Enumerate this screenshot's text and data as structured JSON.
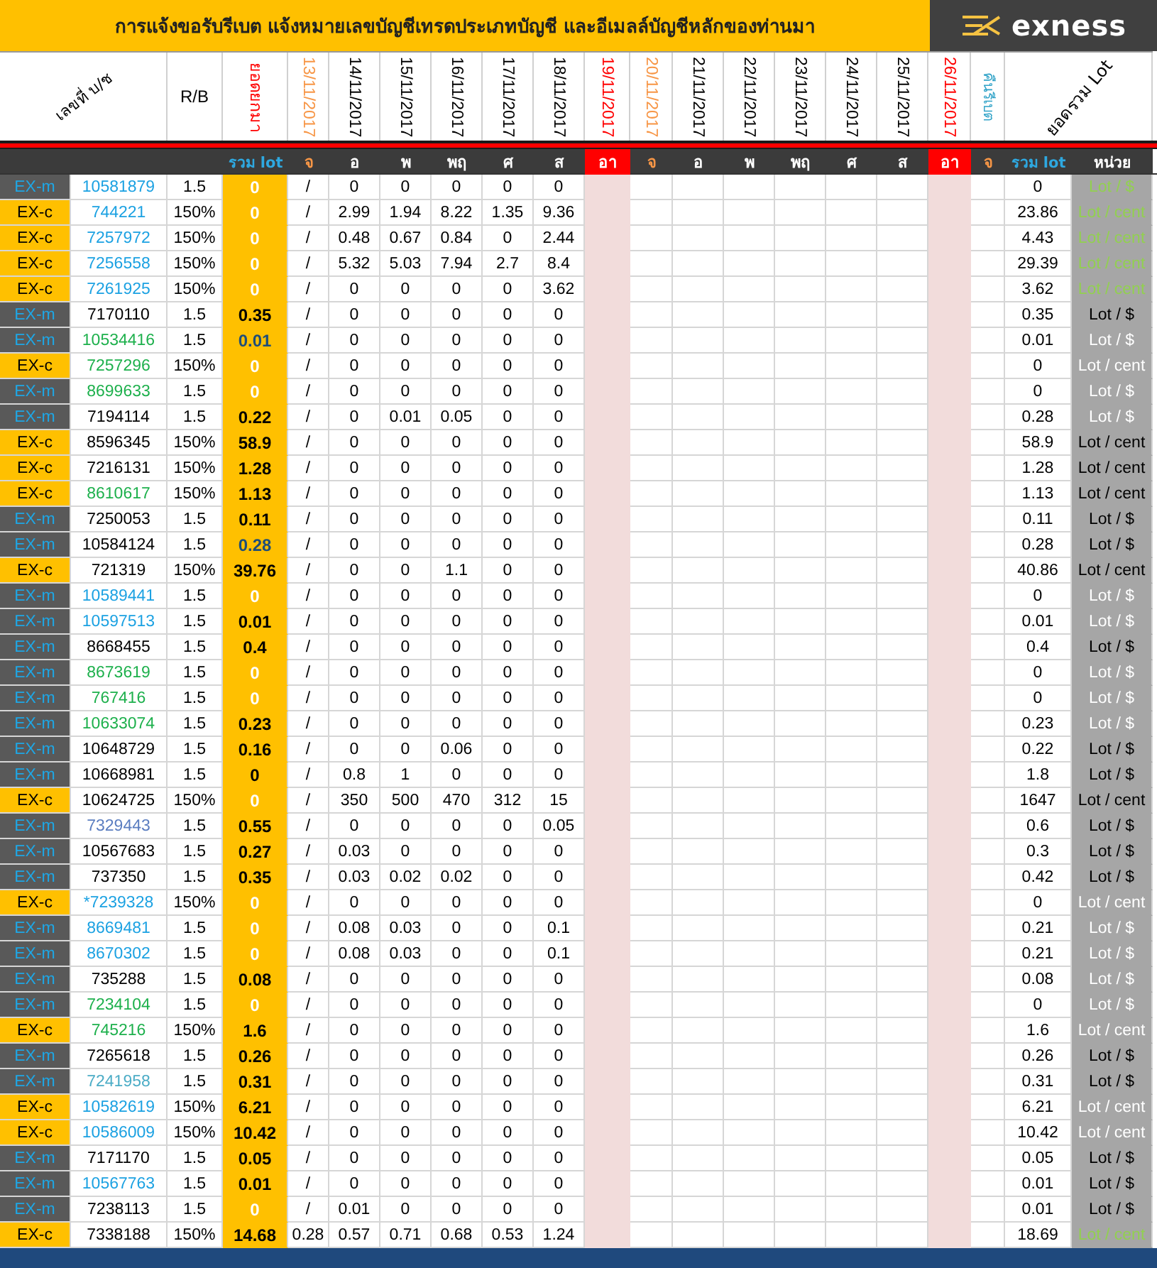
{
  "title": "การแจ้งขอรับรีเบต   แจ้งหมายเลขบัญชีเทรดประเภทบัญชี และอีเมลล์บัญชีหลักของท่านมา",
  "logo": {
    "text": "exness"
  },
  "header": {
    "account_label": "เลขที่ บ/ช",
    "rb_label": "R/B",
    "carried": {
      "text": "ยอดยกมา",
      "color": "#ff0000"
    },
    "dates": [
      {
        "text": "13/11/2017",
        "color": "#f79646"
      },
      {
        "text": "14/11/2017",
        "color": "#000000"
      },
      {
        "text": "15/11/2017",
        "color": "#000000"
      },
      {
        "text": "16/11/2017",
        "color": "#000000"
      },
      {
        "text": "17/11/2017",
        "color": "#000000"
      },
      {
        "text": "18/11/2017",
        "color": "#000000"
      },
      {
        "text": "19/11/2017",
        "color": "#ff0000"
      },
      {
        "text": "20/11/2017",
        "color": "#f79646"
      },
      {
        "text": "21/11/2017",
        "color": "#000000"
      },
      {
        "text": "22/11/2017",
        "color": "#000000"
      },
      {
        "text": "23/11/2017",
        "color": "#000000"
      },
      {
        "text": "24/11/2017",
        "color": "#000000"
      },
      {
        "text": "25/11/2017",
        "color": "#000000"
      },
      {
        "text": "26/11/2017",
        "color": "#ff0000"
      }
    ],
    "rebate": {
      "text": "คืนรีเบต",
      "color": "#31a3c8"
    },
    "total_label": "ยอดรวม Lot"
  },
  "weekday_row": {
    "amount_label": "รวม lot",
    "days": [
      {
        "text": "จ",
        "color": "#f79646",
        "highlight": false
      },
      {
        "text": "อ",
        "color": "#ffffff",
        "highlight": false
      },
      {
        "text": "พ",
        "color": "#ffffff",
        "highlight": false
      },
      {
        "text": "พฤ",
        "color": "#ffffff",
        "highlight": false
      },
      {
        "text": "ศ",
        "color": "#ffffff",
        "highlight": false
      },
      {
        "text": "ส",
        "color": "#ffffff",
        "highlight": false
      },
      {
        "text": "อา",
        "color": "#ffffff",
        "highlight": true
      },
      {
        "text": "จ",
        "color": "#f79646",
        "highlight": false
      },
      {
        "text": "อ",
        "color": "#ffffff",
        "highlight": false
      },
      {
        "text": "พ",
        "color": "#ffffff",
        "highlight": false
      },
      {
        "text": "พฤ",
        "color": "#ffffff",
        "highlight": false
      },
      {
        "text": "ศ",
        "color": "#ffffff",
        "highlight": false
      },
      {
        "text": "ส",
        "color": "#ffffff",
        "highlight": false
      },
      {
        "text": "อา",
        "color": "#ffffff",
        "highlight": true
      }
    ],
    "rebate_day": {
      "text": "จ",
      "color": "#f79646"
    },
    "total_label": "รวม lot",
    "unit_label": "หน่วย"
  },
  "rows": [
    {
      "kind": "exm",
      "type": "EX-m",
      "account": {
        "text": "10581879",
        "color": "#1ba1e2"
      },
      "rb": "1.5",
      "amount": {
        "text": "0",
        "color": "#ffffff"
      },
      "days": [
        "/",
        "0",
        "0",
        "0",
        "0",
        "0"
      ],
      "total": "0",
      "unit": {
        "text": "Lot / $",
        "color": "#92d050"
      }
    },
    {
      "kind": "exc",
      "type": "EX-c",
      "account": {
        "text": "744221",
        "color": "#1ba1e2"
      },
      "rb": "150%",
      "amount": {
        "text": "0",
        "color": "#ffffff"
      },
      "days": [
        "/",
        "2.99",
        "1.94",
        "8.22",
        "1.35",
        "9.36"
      ],
      "total": "23.86",
      "unit": {
        "text": "Lot / cent",
        "color": "#92d050"
      }
    },
    {
      "kind": "exc",
      "type": "EX-c",
      "account": {
        "text": "7257972",
        "color": "#1ba1e2"
      },
      "rb": "150%",
      "amount": {
        "text": "0",
        "color": "#ffffff"
      },
      "days": [
        "/",
        "0.48",
        "0.67",
        "0.84",
        "0",
        "2.44"
      ],
      "total": "4.43",
      "unit": {
        "text": "Lot / cent",
        "color": "#92d050"
      }
    },
    {
      "kind": "exc",
      "type": "EX-c",
      "account": {
        "text": "7256558",
        "color": "#1ba1e2"
      },
      "rb": "150%",
      "amount": {
        "text": "0",
        "color": "#ffffff"
      },
      "days": [
        "/",
        "5.32",
        "5.03",
        "7.94",
        "2.7",
        "8.4"
      ],
      "total": "29.39",
      "unit": {
        "text": "Lot / cent",
        "color": "#92d050"
      }
    },
    {
      "kind": "exc",
      "type": "EX-c",
      "account": {
        "text": "7261925",
        "color": "#1ba1e2"
      },
      "rb": "150%",
      "amount": {
        "text": "0",
        "color": "#ffffff"
      },
      "days": [
        "/",
        "0",
        "0",
        "0",
        "0",
        "3.62"
      ],
      "total": "3.62",
      "unit": {
        "text": "Lot / cent",
        "color": "#92d050"
      }
    },
    {
      "kind": "exm",
      "type": "EX-m",
      "account": {
        "text": "7170110",
        "color": "#000000"
      },
      "rb": "1.5",
      "amount": {
        "text": "0.35",
        "color": "#000000"
      },
      "days": [
        "/",
        "0",
        "0",
        "0",
        "0",
        "0"
      ],
      "total": "0.35",
      "unit": {
        "text": "Lot / $",
        "color": "#000000"
      }
    },
    {
      "kind": "exm",
      "type": "EX-m",
      "account": {
        "text": "10534416",
        "color": "#1db04c"
      },
      "rb": "1.5",
      "amount": {
        "text": "0.01",
        "color": "#1f4e79"
      },
      "days": [
        "/",
        "0",
        "0",
        "0",
        "0",
        "0"
      ],
      "total": "0.01",
      "unit": {
        "text": "Lot / $",
        "color": "#ffffff"
      }
    },
    {
      "kind": "exc",
      "type": "EX-c",
      "account": {
        "text": "7257296",
        "color": "#1db04c"
      },
      "rb": "150%",
      "amount": {
        "text": "0",
        "color": "#ffffff"
      },
      "days": [
        "/",
        "0",
        "0",
        "0",
        "0",
        "0"
      ],
      "total": "0",
      "unit": {
        "text": "Lot / cent",
        "color": "#ffffff"
      }
    },
    {
      "kind": "exm",
      "type": "EX-m",
      "account": {
        "text": "8699633",
        "color": "#1db04c"
      },
      "rb": "1.5",
      "amount": {
        "text": "0",
        "color": "#ffffff"
      },
      "days": [
        "/",
        "0",
        "0",
        "0",
        "0",
        "0"
      ],
      "total": "0",
      "unit": {
        "text": "Lot / $",
        "color": "#ffffff"
      }
    },
    {
      "kind": "exm",
      "type": "EX-m",
      "account": {
        "text": "7194114",
        "color": "#000000"
      },
      "rb": "1.5",
      "amount": {
        "text": "0.22",
        "color": "#000000"
      },
      "days": [
        "/",
        "0",
        "0.01",
        "0.05",
        "0",
        "0"
      ],
      "total": "0.28",
      "unit": {
        "text": "Lot / $",
        "color": "#ffffff"
      }
    },
    {
      "kind": "exc",
      "type": "EX-c",
      "account": {
        "text": "8596345",
        "color": "#000000"
      },
      "rb": "150%",
      "amount": {
        "text": "58.9",
        "color": "#000000"
      },
      "days": [
        "/",
        "0",
        "0",
        "0",
        "0",
        "0"
      ],
      "total": "58.9",
      "unit": {
        "text": "Lot / cent",
        "color": "#000000"
      }
    },
    {
      "kind": "exc",
      "type": "EX-c",
      "account": {
        "text": "7216131",
        "color": "#000000"
      },
      "rb": "150%",
      "amount": {
        "text": "1.28",
        "color": "#000000"
      },
      "days": [
        "/",
        "0",
        "0",
        "0",
        "0",
        "0"
      ],
      "total": "1.28",
      "unit": {
        "text": "Lot / cent",
        "color": "#000000"
      }
    },
    {
      "kind": "exc",
      "type": "EX-c",
      "account": {
        "text": "8610617",
        "color": "#1db04c"
      },
      "rb": "150%",
      "amount": {
        "text": "1.13",
        "color": "#000000"
      },
      "days": [
        "/",
        "0",
        "0",
        "0",
        "0",
        "0"
      ],
      "total": "1.13",
      "unit": {
        "text": "Lot / cent",
        "color": "#000000"
      }
    },
    {
      "kind": "exm",
      "type": "EX-m",
      "account": {
        "text": "7250053",
        "color": "#000000"
      },
      "rb": "1.5",
      "amount": {
        "text": "0.11",
        "color": "#000000"
      },
      "days": [
        "/",
        "0",
        "0",
        "0",
        "0",
        "0"
      ],
      "total": "0.11",
      "unit": {
        "text": "Lot / $",
        "color": "#000000"
      }
    },
    {
      "kind": "exm",
      "type": "EX-m",
      "account": {
        "text": "10584124",
        "color": "#000000"
      },
      "rb": "1.5",
      "amount": {
        "text": "0.28",
        "color": "#1f4e79"
      },
      "days": [
        "/",
        "0",
        "0",
        "0",
        "0",
        "0"
      ],
      "total": "0.28",
      "unit": {
        "text": "Lot / $",
        "color": "#000000"
      }
    },
    {
      "kind": "exc",
      "type": "EX-c",
      "account": {
        "text": "721319",
        "color": "#000000"
      },
      "rb": "150%",
      "amount": {
        "text": "39.76",
        "color": "#000000"
      },
      "days": [
        "/",
        "0",
        "0",
        "1.1",
        "0",
        "0"
      ],
      "total": "40.86",
      "unit": {
        "text": "Lot / cent",
        "color": "#000000"
      }
    },
    {
      "kind": "exm",
      "type": "EX-m",
      "account": {
        "text": "10589441",
        "color": "#1ba1e2"
      },
      "rb": "1.5",
      "amount": {
        "text": "0",
        "color": "#ffffff"
      },
      "days": [
        "/",
        "0",
        "0",
        "0",
        "0",
        "0"
      ],
      "total": "0",
      "unit": {
        "text": "Lot / $",
        "color": "#ffffff"
      }
    },
    {
      "kind": "exm",
      "type": "EX-m",
      "account": {
        "text": "10597513",
        "color": "#1ba1e2"
      },
      "rb": "1.5",
      "amount": {
        "text": "0.01",
        "color": "#000000"
      },
      "days": [
        "/",
        "0",
        "0",
        "0",
        "0",
        "0"
      ],
      "total": "0.01",
      "unit": {
        "text": "Lot / $",
        "color": "#ffffff"
      }
    },
    {
      "kind": "exm",
      "type": "EX-m",
      "account": {
        "text": "8668455",
        "color": "#000000"
      },
      "rb": "1.5",
      "amount": {
        "text": "0.4",
        "color": "#000000"
      },
      "days": [
        "/",
        "0",
        "0",
        "0",
        "0",
        "0"
      ],
      "total": "0.4",
      "unit": {
        "text": "Lot / $",
        "color": "#000000"
      }
    },
    {
      "kind": "exm",
      "type": "EX-m",
      "account": {
        "text": "8673619",
        "color": "#1db04c"
      },
      "rb": "1.5",
      "amount": {
        "text": "0",
        "color": "#ffffff"
      },
      "days": [
        "/",
        "0",
        "0",
        "0",
        "0",
        "0"
      ],
      "total": "0",
      "unit": {
        "text": "Lot / $",
        "color": "#ffffff"
      }
    },
    {
      "kind": "exm",
      "type": "EX-m",
      "account": {
        "text": "767416",
        "color": "#1db04c"
      },
      "rb": "1.5",
      "amount": {
        "text": "0",
        "color": "#ffffff"
      },
      "days": [
        "/",
        "0",
        "0",
        "0",
        "0",
        "0"
      ],
      "total": "0",
      "unit": {
        "text": "Lot / $",
        "color": "#ffffff"
      }
    },
    {
      "kind": "exm",
      "type": "EX-m",
      "account": {
        "text": "10633074",
        "color": "#1db04c"
      },
      "rb": "1.5",
      "amount": {
        "text": "0.23",
        "color": "#000000"
      },
      "days": [
        "/",
        "0",
        "0",
        "0",
        "0",
        "0"
      ],
      "total": "0.23",
      "unit": {
        "text": "Lot / $",
        "color": "#ffffff"
      }
    },
    {
      "kind": "exm",
      "type": "EX-m",
      "account": {
        "text": "10648729",
        "color": "#000000"
      },
      "rb": "1.5",
      "amount": {
        "text": "0.16",
        "color": "#000000"
      },
      "days": [
        "/",
        "0",
        "0",
        "0.06",
        "0",
        "0"
      ],
      "total": "0.22",
      "unit": {
        "text": "Lot / $",
        "color": "#000000"
      }
    },
    {
      "kind": "exm",
      "type": "EX-m",
      "account": {
        "text": "10668981",
        "color": "#000000"
      },
      "rb": "1.5",
      "amount": {
        "text": "0",
        "color": "#000000"
      },
      "days": [
        "/",
        "0.8",
        "1",
        "0",
        "0",
        "0"
      ],
      "total": "1.8",
      "unit": {
        "text": "Lot / $",
        "color": "#000000"
      }
    },
    {
      "kind": "exc",
      "type": "EX-c",
      "account": {
        "text": "10624725",
        "color": "#000000"
      },
      "rb": "150%",
      "amount": {
        "text": "0",
        "color": "#ffffff"
      },
      "days": [
        "/",
        "350",
        "500",
        "470",
        "312",
        "15"
      ],
      "total": "1647",
      "unit": {
        "text": "Lot / cent",
        "color": "#000000"
      }
    },
    {
      "kind": "exm",
      "type": "EX-m",
      "account": {
        "text": "7329443",
        "color": "#5a7dc0"
      },
      "rb": "1.5",
      "amount": {
        "text": "0.55",
        "color": "#000000"
      },
      "days": [
        "/",
        "0",
        "0",
        "0",
        "0",
        "0.05"
      ],
      "total": "0.6",
      "unit": {
        "text": "Lot / $",
        "color": "#000000"
      }
    },
    {
      "kind": "exm",
      "type": "EX-m",
      "account": {
        "text": "10567683",
        "color": "#000000"
      },
      "rb": "1.5",
      "amount": {
        "text": "0.27",
        "color": "#000000"
      },
      "days": [
        "/",
        "0.03",
        "0",
        "0",
        "0",
        "0"
      ],
      "total": "0.3",
      "unit": {
        "text": "Lot / $",
        "color": "#000000"
      }
    },
    {
      "kind": "exm",
      "type": "EX-m",
      "account": {
        "text": "737350",
        "color": "#000000"
      },
      "rb": "1.5",
      "amount": {
        "text": "0.35",
        "color": "#000000"
      },
      "days": [
        "/",
        "0.03",
        "0.02",
        "0.02",
        "0",
        "0"
      ],
      "total": "0.42",
      "unit": {
        "text": "Lot / $",
        "color": "#000000"
      }
    },
    {
      "kind": "exc",
      "type": "EX-c",
      "account": {
        "text": "*7239328",
        "color": "#1ba1e2"
      },
      "rb": "150%",
      "amount": {
        "text": "0",
        "color": "#ffffff"
      },
      "days": [
        "/",
        "0",
        "0",
        "0",
        "0",
        "0"
      ],
      "total": "0",
      "unit": {
        "text": "Lot / cent",
        "color": "#ffffff"
      }
    },
    {
      "kind": "exm",
      "type": "EX-m",
      "account": {
        "text": "8669481",
        "color": "#1ba1e2"
      },
      "rb": "1.5",
      "amount": {
        "text": "0",
        "color": "#ffffff"
      },
      "days": [
        "/",
        "0.08",
        "0.03",
        "0",
        "0",
        "0.1"
      ],
      "total": "0.21",
      "unit": {
        "text": "Lot / $",
        "color": "#ffffff"
      }
    },
    {
      "kind": "exm",
      "type": "EX-m",
      "account": {
        "text": "8670302",
        "color": "#1ba1e2"
      },
      "rb": "1.5",
      "amount": {
        "text": "0",
        "color": "#ffffff"
      },
      "days": [
        "/",
        "0.08",
        "0.03",
        "0",
        "0",
        "0.1"
      ],
      "total": "0.21",
      "unit": {
        "text": "Lot / $",
        "color": "#ffffff"
      }
    },
    {
      "kind": "exm",
      "type": "EX-m",
      "account": {
        "text": "735288",
        "color": "#000000"
      },
      "rb": "1.5",
      "amount": {
        "text": "0.08",
        "color": "#000000"
      },
      "days": [
        "/",
        "0",
        "0",
        "0",
        "0",
        "0"
      ],
      "total": "0.08",
      "unit": {
        "text": "Lot / $",
        "color": "#ffffff"
      }
    },
    {
      "kind": "exm",
      "type": "EX-m",
      "account": {
        "text": "7234104",
        "color": "#1db04c"
      },
      "rb": "1.5",
      "amount": {
        "text": "0",
        "color": "#ffffff"
      },
      "days": [
        "/",
        "0",
        "0",
        "0",
        "0",
        "0"
      ],
      "total": "0",
      "unit": {
        "text": "Lot / $",
        "color": "#ffffff"
      }
    },
    {
      "kind": "exc",
      "type": "EX-c",
      "account": {
        "text": "745216",
        "color": "#1db04c"
      },
      "rb": "150%",
      "amount": {
        "text": "1.6",
        "color": "#000000"
      },
      "days": [
        "/",
        "0",
        "0",
        "0",
        "0",
        "0"
      ],
      "total": "1.6",
      "unit": {
        "text": "Lot / cent",
        "color": "#ffffff"
      }
    },
    {
      "kind": "exm",
      "type": "EX-m",
      "account": {
        "text": "7265618",
        "color": "#000000"
      },
      "rb": "1.5",
      "amount": {
        "text": "0.26",
        "color": "#000000"
      },
      "days": [
        "/",
        "0",
        "0",
        "0",
        "0",
        "0"
      ],
      "total": "0.26",
      "unit": {
        "text": "Lot / $",
        "color": "#000000"
      }
    },
    {
      "kind": "exm",
      "type": "EX-m",
      "account": {
        "text": "7241958",
        "color": "#4bacc6"
      },
      "rb": "1.5",
      "amount": {
        "text": "0.31",
        "color": "#000000"
      },
      "days": [
        "/",
        "0",
        "0",
        "0",
        "0",
        "0"
      ],
      "total": "0.31",
      "unit": {
        "text": "Lot / $",
        "color": "#000000"
      }
    },
    {
      "kind": "exc",
      "type": "EX-c",
      "account": {
        "text": "10582619",
        "color": "#1ba1e2"
      },
      "rb": "150%",
      "amount": {
        "text": "6.21",
        "color": "#000000"
      },
      "days": [
        "/",
        "0",
        "0",
        "0",
        "0",
        "0"
      ],
      "total": "6.21",
      "unit": {
        "text": "Lot / cent",
        "color": "#ffffff"
      }
    },
    {
      "kind": "exc",
      "type": "EX-c",
      "account": {
        "text": "10586009",
        "color": "#1ba1e2"
      },
      "rb": "150%",
      "amount": {
        "text": "10.42",
        "color": "#000000"
      },
      "days": [
        "/",
        "0",
        "0",
        "0",
        "0",
        "0"
      ],
      "total": "10.42",
      "unit": {
        "text": "Lot / cent",
        "color": "#ffffff"
      }
    },
    {
      "kind": "exm",
      "type": "EX-m",
      "account": {
        "text": "7171170",
        "color": "#000000"
      },
      "rb": "1.5",
      "amount": {
        "text": "0.05",
        "color": "#000000"
      },
      "days": [
        "/",
        "0",
        "0",
        "0",
        "0",
        "0"
      ],
      "total": "0.05",
      "unit": {
        "text": "Lot / $",
        "color": "#000000"
      }
    },
    {
      "kind": "exm",
      "type": "EX-m",
      "account": {
        "text": "10567763",
        "color": "#1ba1e2"
      },
      "rb": "1.5",
      "amount": {
        "text": "0.01",
        "color": "#000000"
      },
      "days": [
        "/",
        "0",
        "0",
        "0",
        "0",
        "0"
      ],
      "total": "0.01",
      "unit": {
        "text": "Lot / $",
        "color": "#000000"
      }
    },
    {
      "kind": "exm",
      "type": "EX-m",
      "account": {
        "text": "7238113",
        "color": "#000000"
      },
      "rb": "1.5",
      "amount": {
        "text": "0",
        "color": "#ffffff"
      },
      "days": [
        "/",
        "0.01",
        "0",
        "0",
        "0",
        "0"
      ],
      "total": "0.01",
      "unit": {
        "text": "Lot / $",
        "color": "#000000"
      }
    },
    {
      "kind": "exc",
      "type": "EX-c",
      "account": {
        "text": "7338188",
        "color": "#000000"
      },
      "rb": "150%",
      "amount": {
        "text": "14.68",
        "color": "#000000"
      },
      "days": [
        "0.28",
        "0.57",
        "0.71",
        "0.68",
        "0.53",
        "1.24"
      ],
      "total": "18.69",
      "unit": {
        "text": "Lot / cent",
        "color": "#92d050"
      }
    }
  ]
}
